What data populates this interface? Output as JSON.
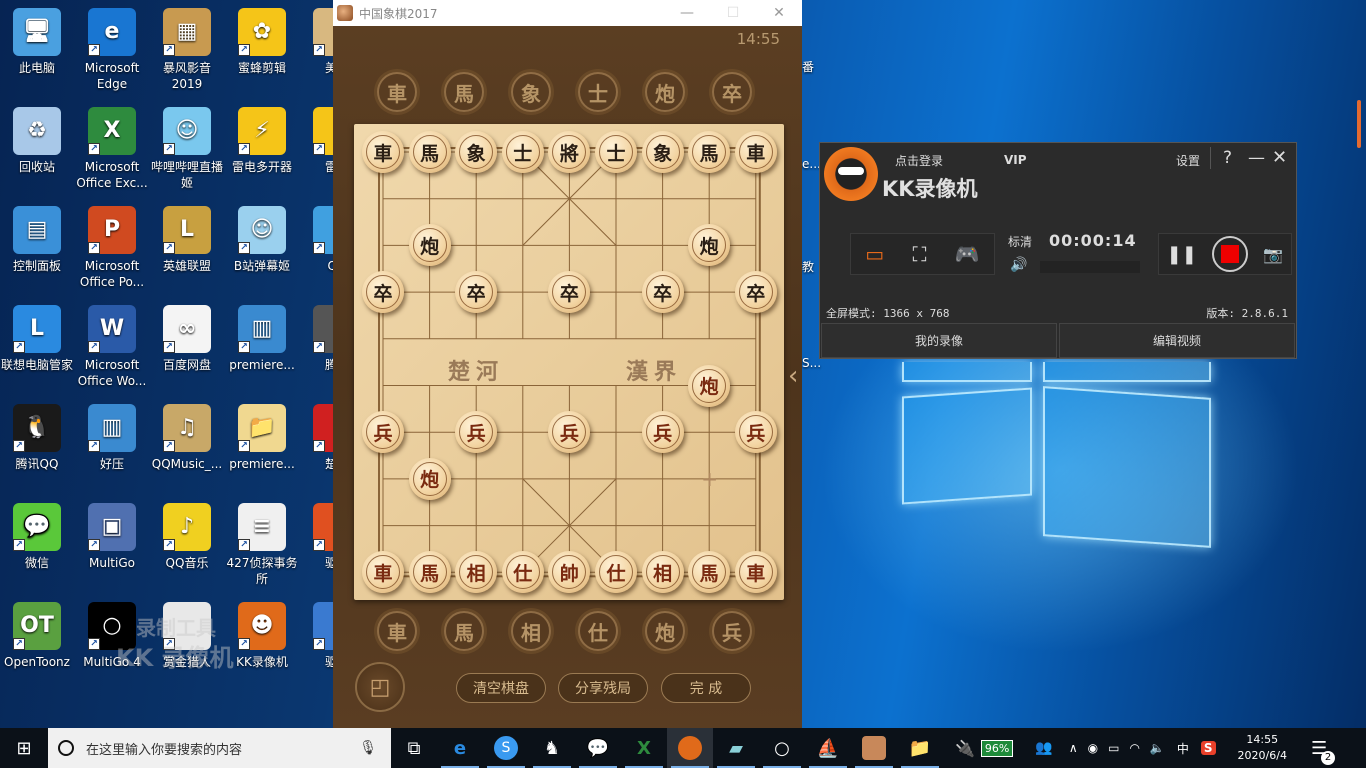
{
  "desktop": {
    "icons": [
      {
        "label": "此电脑",
        "col": 0,
        "row": 0,
        "color": "#4aa0e0",
        "glyph": "🖥"
      },
      {
        "label": "Microsoft Edge",
        "col": 1,
        "row": 0,
        "color": "#1976d2",
        "glyph": "e"
      },
      {
        "label": "暴风影音 2019",
        "col": 2,
        "row": 0,
        "color": "#c89a50",
        "glyph": "▦"
      },
      {
        "label": "蜜蜂剪辑",
        "col": 3,
        "row": 0,
        "color": "#f5c518",
        "glyph": "✿"
      },
      {
        "label": "美帧",
        "col": 4,
        "row": 0,
        "color": "#d8b880",
        "glyph": ""
      },
      {
        "label": "回收站",
        "col": 0,
        "row": 1,
        "color": "#a8c8e8",
        "glyph": "♻"
      },
      {
        "label": "Microsoft Office Exc...",
        "col": 1,
        "row": 1,
        "color": "#2e8b3e",
        "glyph": "X"
      },
      {
        "label": "哔哩哔哩直播姬",
        "col": 2,
        "row": 1,
        "color": "#7ac8ee",
        "glyph": "☺"
      },
      {
        "label": "雷电多开器",
        "col": 3,
        "row": 1,
        "color": "#f5c518",
        "glyph": "⚡"
      },
      {
        "label": "雷电",
        "col": 4,
        "row": 1,
        "color": "#f5c518",
        "glyph": ""
      },
      {
        "label": "控制面板",
        "col": 0,
        "row": 2,
        "color": "#3a90d8",
        "glyph": "▤"
      },
      {
        "label": "Microsoft Office Po...",
        "col": 1,
        "row": 2,
        "color": "#d04a20",
        "glyph": "P"
      },
      {
        "label": "英雄联盟",
        "col": 2,
        "row": 2,
        "color": "#c8a040",
        "glyph": "L"
      },
      {
        "label": "B站弹幕姬",
        "col": 3,
        "row": 2,
        "color": "#9ad0ee",
        "glyph": "☺"
      },
      {
        "label": "QQ",
        "col": 4,
        "row": 2,
        "color": "#40a0e0",
        "glyph": ""
      },
      {
        "label": "联想电脑管家",
        "col": 0,
        "row": 3,
        "color": "#2a8ae0",
        "glyph": "L"
      },
      {
        "label": "Microsoft Office Wo...",
        "col": 1,
        "row": 3,
        "color": "#2a5aa8",
        "glyph": "W"
      },
      {
        "label": "百度网盘",
        "col": 2,
        "row": 3,
        "color": "#f4f4f4",
        "glyph": "∞"
      },
      {
        "label": "premiere...",
        "col": 3,
        "row": 3,
        "color": "#3a8ad0",
        "glyph": "▥"
      },
      {
        "label": "腾讯",
        "col": 4,
        "row": 3,
        "color": "#555",
        "glyph": ""
      },
      {
        "label": "腾讯QQ",
        "col": 0,
        "row": 4,
        "color": "#1a1a1a",
        "glyph": "🐧"
      },
      {
        "label": "好压",
        "col": 1,
        "row": 4,
        "color": "#3a8ad0",
        "glyph": "▥"
      },
      {
        "label": "QQMusic_...",
        "col": 2,
        "row": 4,
        "color": "#c8a868",
        "glyph": "♫"
      },
      {
        "label": "premiere...",
        "col": 3,
        "row": 4,
        "color": "#f0d890",
        "glyph": "📁"
      },
      {
        "label": "楚汉",
        "col": 4,
        "row": 4,
        "color": "#d02020",
        "glyph": ""
      },
      {
        "label": "微信",
        "col": 0,
        "row": 5,
        "color": "#5ac83a",
        "glyph": "💬"
      },
      {
        "label": "MultiGo",
        "col": 1,
        "row": 5,
        "color": "#5070b0",
        "glyph": "▣"
      },
      {
        "label": "QQ音乐",
        "col": 2,
        "row": 5,
        "color": "#f0d020",
        "glyph": "♪"
      },
      {
        "label": "427侦探事务所",
        "col": 3,
        "row": 5,
        "color": "#f0f0f0",
        "glyph": "≡"
      },
      {
        "label": "驱动",
        "col": 4,
        "row": 5,
        "color": "#e05020",
        "glyph": ""
      },
      {
        "label": "OpenToonz",
        "col": 0,
        "row": 6,
        "color": "#5aa040",
        "glyph": "OT"
      },
      {
        "label": "MultiGo 4",
        "col": 1,
        "row": 6,
        "color": "#000",
        "glyph": "○"
      },
      {
        "label": "赏金猎人",
        "col": 2,
        "row": 6,
        "color": "#e8e8e8",
        "glyph": ""
      },
      {
        "label": "KK录像机",
        "col": 3,
        "row": 6,
        "color": "#e06a1a",
        "glyph": "☻"
      },
      {
        "label": "驱动",
        "col": 4,
        "row": 6,
        "color": "#3a7ad0",
        "glyph": ""
      }
    ],
    "partial_labels_right": [
      "番",
      "e...",
      "教",
      "S..."
    ]
  },
  "watermark": {
    "line1": "录制工具",
    "line2": "KK 录像机"
  },
  "chess_window": {
    "title": "中国象棋2017",
    "minimize": "—",
    "maximize": "☐",
    "close": "✕",
    "clock": "14:55",
    "tray_black": [
      "車",
      "馬",
      "象",
      "士",
      "炮",
      "卒"
    ],
    "tray_red": [
      "車",
      "馬",
      "相",
      "仕",
      "炮",
      "兵"
    ],
    "river_left": "楚河",
    "river_right": "漢界",
    "pieces": [
      {
        "char": "車",
        "side": "black",
        "col": 0,
        "row": 0
      },
      {
        "char": "馬",
        "side": "black",
        "col": 1,
        "row": 0
      },
      {
        "char": "象",
        "side": "black",
        "col": 2,
        "row": 0
      },
      {
        "char": "士",
        "side": "black",
        "col": 3,
        "row": 0
      },
      {
        "char": "將",
        "side": "black",
        "col": 4,
        "row": 0
      },
      {
        "char": "士",
        "side": "black",
        "col": 5,
        "row": 0
      },
      {
        "char": "象",
        "side": "black",
        "col": 6,
        "row": 0
      },
      {
        "char": "馬",
        "side": "black",
        "col": 7,
        "row": 0
      },
      {
        "char": "車",
        "side": "black",
        "col": 8,
        "row": 0
      },
      {
        "char": "炮",
        "side": "black",
        "col": 1,
        "row": 2
      },
      {
        "char": "炮",
        "side": "black",
        "col": 7,
        "row": 2
      },
      {
        "char": "卒",
        "side": "black",
        "col": 0,
        "row": 3
      },
      {
        "char": "卒",
        "side": "black",
        "col": 2,
        "row": 3
      },
      {
        "char": "卒",
        "side": "black",
        "col": 4,
        "row": 3
      },
      {
        "char": "卒",
        "side": "black",
        "col": 6,
        "row": 3
      },
      {
        "char": "卒",
        "side": "black",
        "col": 8,
        "row": 3
      },
      {
        "char": "炮",
        "side": "red",
        "col": 7,
        "row": 5
      },
      {
        "char": "兵",
        "side": "red",
        "col": 0,
        "row": 6
      },
      {
        "char": "兵",
        "side": "red",
        "col": 2,
        "row": 6
      },
      {
        "char": "兵",
        "side": "red",
        "col": 4,
        "row": 6
      },
      {
        "char": "兵",
        "side": "red",
        "col": 6,
        "row": 6
      },
      {
        "char": "兵",
        "side": "red",
        "col": 8,
        "row": 6
      },
      {
        "char": "炮",
        "side": "red",
        "col": 1,
        "row": 7
      },
      {
        "char": "車",
        "side": "red",
        "col": 0,
        "row": 9
      },
      {
        "char": "馬",
        "side": "red",
        "col": 1,
        "row": 9
      },
      {
        "char": "相",
        "side": "red",
        "col": 2,
        "row": 9
      },
      {
        "char": "仕",
        "side": "red",
        "col": 3,
        "row": 9
      },
      {
        "char": "帥",
        "side": "red",
        "col": 4,
        "row": 9
      },
      {
        "char": "仕",
        "side": "red",
        "col": 5,
        "row": 9
      },
      {
        "char": "相",
        "side": "red",
        "col": 6,
        "row": 9
      },
      {
        "char": "馬",
        "side": "red",
        "col": 7,
        "row": 9
      },
      {
        "char": "車",
        "side": "red",
        "col": 8,
        "row": 9
      }
    ],
    "buttons": {
      "clear": "清空棋盘",
      "share": "分享残局",
      "done": "完 成"
    }
  },
  "kk_recorder": {
    "login": "点击登录",
    "vip": "VIP",
    "brand": "KK录像机",
    "settings": "设置",
    "help": "?",
    "minimize": "—",
    "close": "✕",
    "quality": "标清",
    "timer": "00:00:14",
    "mode_text": "全屏模式: 1366 x 768",
    "version": "版本: 2.8.6.1",
    "my_recordings": "我的录像",
    "edit_video": "编辑视频",
    "accent": "#e86a1a",
    "record_color": "#ee0000"
  },
  "taskbar": {
    "search_placeholder": "在这里输入你要搜索的内容",
    "battery": "96%",
    "time": "14:55",
    "date": "2020/6/4",
    "ime": "中",
    "notifications": "2",
    "apps": [
      "task-view",
      "edge",
      "sogou",
      "game",
      "wechat",
      "excel",
      "kk-recorder",
      "notes",
      "multigo",
      "qq-game",
      "chess",
      "file-explorer"
    ]
  }
}
